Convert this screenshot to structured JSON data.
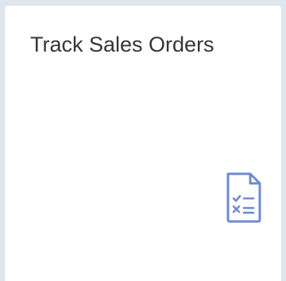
{
  "tile": {
    "title": "Track Sales Orders",
    "icon": "task-list-icon",
    "icon_color": "#6e8bcc",
    "background": "#ffffff",
    "page_background": "#dfe6ee",
    "title_color": "#32363a"
  }
}
